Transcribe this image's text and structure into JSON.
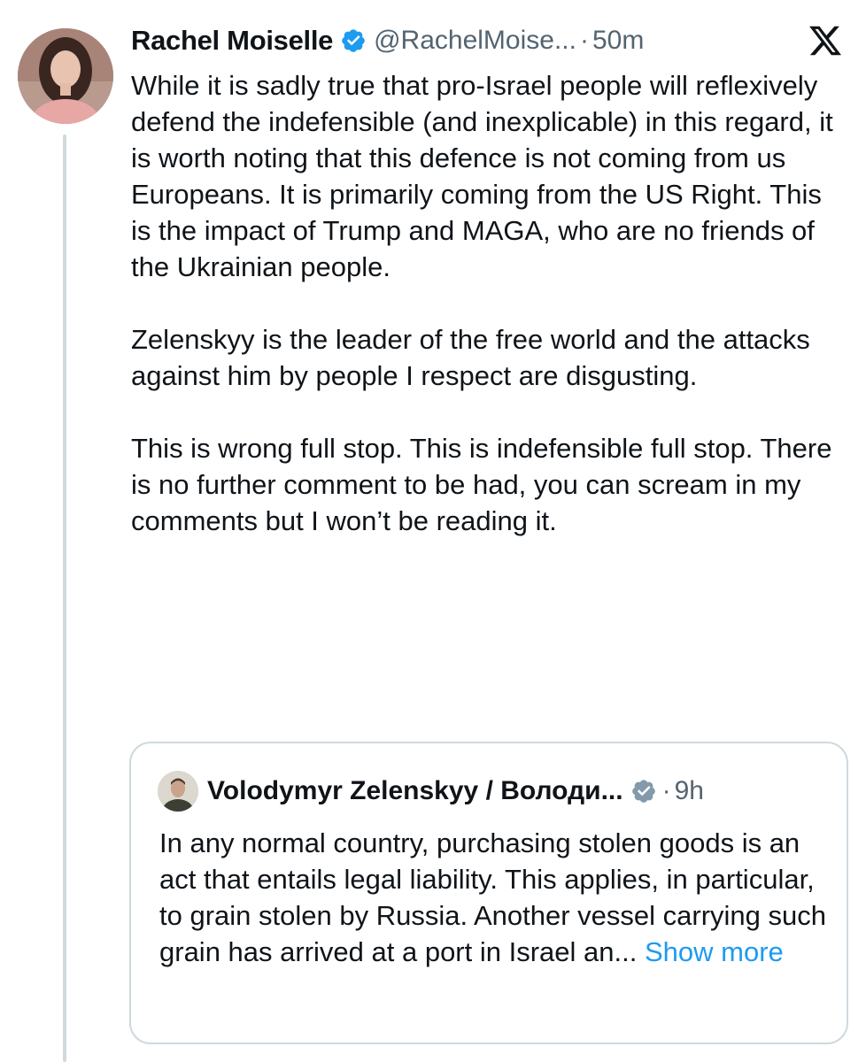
{
  "tweet": {
    "author_name": "Rachel Moiselle",
    "handle": "@RachelMoise...",
    "separator": "·",
    "time": "50m",
    "paragraphs": [
      "While it is sadly true that pro-Israel people will reflexively defend the indefensible (and inexplicable) in this regard, it is worth noting that this defence is not coming from us Europeans. It is primarily coming from the US Right. This is the impact of Trump and MAGA, who are no friends of the Ukrainian people.",
      "Zelenskyy is the leader of the free world and the attacks against him by people I respect are disgusting.",
      "This is wrong full stop. This is indefensible full stop. There is no further comment to be had, you can scream in my comments but I won’t be reading it."
    ]
  },
  "quoted_tweet": {
    "author_name": "Volodymyr Zelenskyy / Володи...",
    "separator": "·",
    "time": "9h",
    "text": "In any normal country, purchasing stolen goods is an act that entails legal liability. This applies, in particular, to grain stolen by Russia. Another vessel carrying such grain has arrived at a port in Israel an...",
    "show_more": "Show more"
  },
  "icons": {
    "verified": "verified-badge-icon",
    "quote_verified": "gray-verified-badge-icon",
    "platform": "x-logo-icon"
  },
  "colors": {
    "text": "#0f1419",
    "secondary": "#536471",
    "verified_blue": "#1d9bf0",
    "verified_gray": "#829aab",
    "link": "#1d9bf0",
    "border": "#cfd9de"
  }
}
